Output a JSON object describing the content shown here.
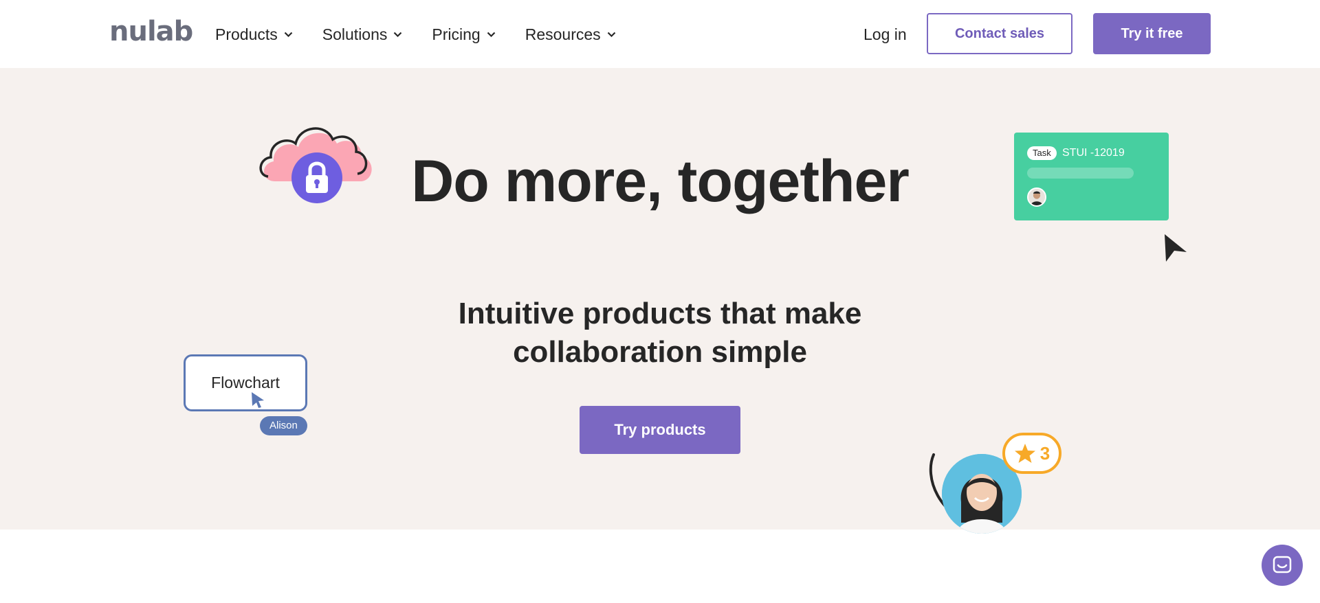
{
  "header": {
    "logo_text": "nulab",
    "nav": [
      {
        "label": "Products"
      },
      {
        "label": "Solutions"
      },
      {
        "label": "Pricing"
      },
      {
        "label": "Resources"
      }
    ],
    "login_label": "Log in",
    "contact_label": "Contact sales",
    "try_free_label": "Try it free"
  },
  "hero": {
    "title": "Do more, together",
    "subtitle": "Intuitive products that make collaboration simple",
    "cta_label": "Try products",
    "task_card": {
      "badge": "Task",
      "id": "STUI -12019"
    },
    "flowchart": {
      "label": "Flowchart",
      "user_tag": "Alison"
    },
    "star_badge": {
      "count": "3"
    }
  },
  "colors": {
    "brand": "#7b68c2",
    "hero_bg": "#f6f1ee",
    "task_green": "#47cfa0",
    "flow_blue": "#5b78b4",
    "star_orange": "#f7a928"
  },
  "icons": [
    "chevron-down-icon",
    "cloud-icon",
    "lock-icon",
    "cursor-icon",
    "star-icon",
    "chat-icon"
  ]
}
